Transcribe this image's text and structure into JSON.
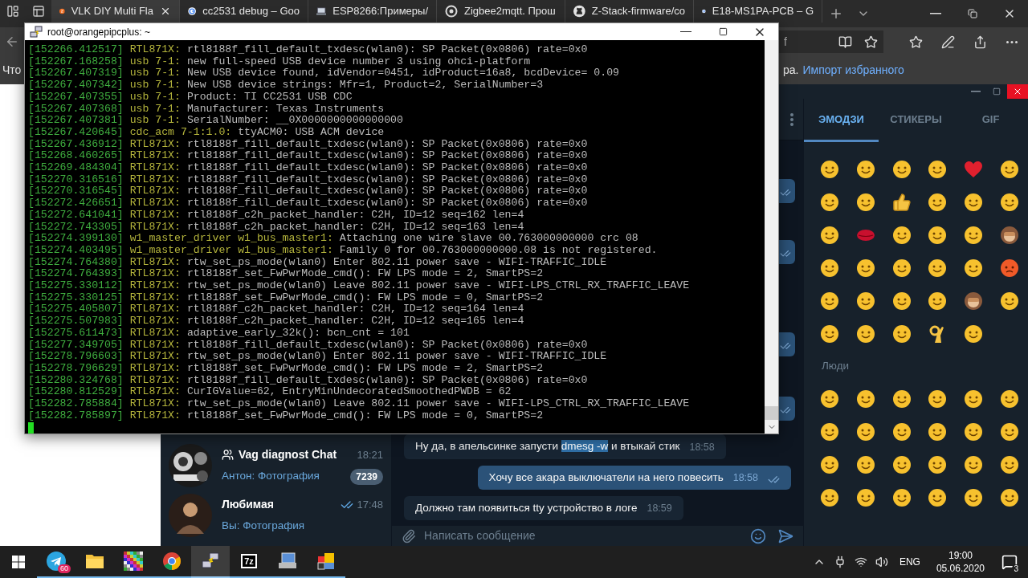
{
  "browser": {
    "tabs": [
      {
        "title": "VLK DIY Multi Fla",
        "selected": true
      },
      {
        "title": "cc2531 debug – Goo",
        "selected": false
      },
      {
        "title": "ESP8266:Примеры/",
        "selected": false
      },
      {
        "title": "Zigbee2mqtt. Прош",
        "selected": false
      },
      {
        "title": "Z-Stack-firmware/co",
        "selected": false
      },
      {
        "title": "E18-MS1PA-PCB – G",
        "selected": false
      }
    ],
    "address_fragment": "f",
    "favorites_bar": {
      "left_fragment": "Что",
      "right_fragment": "ра.",
      "link": "Импорт избранного"
    }
  },
  "telegram": {
    "chats": [
      {
        "name": "Vag diagnost Chat",
        "group": true,
        "time": "18:21",
        "preview": "Антон: Фотография",
        "unread": "7239",
        "read_receipt": false
      },
      {
        "name": "Любимая",
        "group": false,
        "time": "17:48",
        "preview": "Вы: Фотография",
        "read_receipt": true
      }
    ],
    "messages": [
      {
        "kind": "incoming",
        "parts": [
          {
            "text": "Ну да, в апельсинке запусти ",
            "selected": false
          },
          {
            "text": "dmesg -w",
            "selected": true
          },
          {
            "text": " и втыкай стик",
            "selected": false
          }
        ],
        "time": "18:58",
        "read": false
      },
      {
        "kind": "outgoing",
        "parts": [
          {
            "text": "Хочу все акара выключатели на него повесить",
            "selected": false
          }
        ],
        "time": "18:58",
        "read": true
      },
      {
        "kind": "incoming",
        "parts": [
          {
            "text": "Должно там появиться tty устройство в логе",
            "selected": false
          }
        ],
        "time": "18:59",
        "read": false
      }
    ],
    "composer": {
      "placeholder": "Написать сообщение"
    },
    "emoji_tabs": [
      {
        "label": "ЭМОДЗИ",
        "selected": true
      },
      {
        "label": "СТИКЕРЫ",
        "selected": false
      },
      {
        "label": "GIF",
        "selected": false
      }
    ],
    "section_label": "Люди"
  },
  "terminal": {
    "title": "root@orangepipcplus: ~",
    "lines": [
      {
        "timestamp": "[152266.412517]",
        "source": "RTL871X:",
        "message": "rtl8188f_fill_default_txdesc(wlan0): SP Packet(0x0806) rate=0x0"
      },
      {
        "timestamp": "[152267.168258]",
        "source": "usb 7-1:",
        "message": "new full-speed USB device number 3 using ohci-platform"
      },
      {
        "timestamp": "[152267.407319]",
        "source": "usb 7-1:",
        "message": "New USB device found, idVendor=0451, idProduct=16a8, bcdDevice= 0.09"
      },
      {
        "timestamp": "[152267.407342]",
        "source": "usb 7-1:",
        "message": "New USB device strings: Mfr=1, Product=2, SerialNumber=3"
      },
      {
        "timestamp": "[152267.407355]",
        "source": "usb 7-1:",
        "message": "Product: TI CC2531 USB CDC"
      },
      {
        "timestamp": "[152267.407368]",
        "source": "usb 7-1:",
        "message": "Manufacturer: Texas Instruments"
      },
      {
        "timestamp": "[152267.407381]",
        "source": "usb 7-1:",
        "message": "SerialNumber: __0X0000000000000000"
      },
      {
        "timestamp": "[152267.420645]",
        "source": "cdc_acm 7-1:1.0:",
        "message": "ttyACM0: USB ACM device"
      },
      {
        "timestamp": "[152267.436912]",
        "source": "RTL871X:",
        "message": "rtl8188f_fill_default_txdesc(wlan0): SP Packet(0x0806) rate=0x0"
      },
      {
        "timestamp": "[152268.460265]",
        "source": "RTL871X:",
        "message": "rtl8188f_fill_default_txdesc(wlan0): SP Packet(0x0806) rate=0x0"
      },
      {
        "timestamp": "[152269.484304]",
        "source": "RTL871X:",
        "message": "rtl8188f_fill_default_txdesc(wlan0): SP Packet(0x0806) rate=0x0"
      },
      {
        "timestamp": "[152270.316516]",
        "source": "RTL871X:",
        "message": "rtl8188f_fill_default_txdesc(wlan0): SP Packet(0x0806) rate=0x0"
      },
      {
        "timestamp": "[152270.316545]",
        "source": "RTL871X:",
        "message": "rtl8188f_fill_default_txdesc(wlan0): SP Packet(0x0806) rate=0x0"
      },
      {
        "timestamp": "[152272.426651]",
        "source": "RTL871X:",
        "message": "rtl8188f_fill_default_txdesc(wlan0): SP Packet(0x0806) rate=0x0"
      },
      {
        "timestamp": "[152272.641041]",
        "source": "RTL871X:",
        "message": "rtl8188f_c2h_packet_handler: C2H, ID=12 seq=162 len=4"
      },
      {
        "timestamp": "[152272.743305]",
        "source": "RTL871X:",
        "message": "rtl8188f_c2h_packet_handler: C2H, ID=12 seq=163 len=4"
      },
      {
        "timestamp": "[152274.399130]",
        "source": "w1_master_driver w1_bus_master1:",
        "message": "Attaching one wire slave 00.763000000000 crc 08"
      },
      {
        "timestamp": "[152274.403495]",
        "source": "w1_master_driver w1_bus_master1:",
        "message": "Family 0 for 00.763000000000.08 is not registered."
      },
      {
        "timestamp": "[152274.764380]",
        "source": "RTL871X:",
        "message": "rtw_set_ps_mode(wlan0) Enter 802.11 power save - WIFI-TRAFFIC_IDLE"
      },
      {
        "timestamp": "[152274.764393]",
        "source": "RTL871X:",
        "message": "rtl8188f_set_FwPwrMode_cmd(): FW LPS mode = 2, SmartPS=2"
      },
      {
        "timestamp": "[152275.330112]",
        "source": "RTL871X:",
        "message": "rtw_set_ps_mode(wlan0) Leave 802.11 power save - WIFI-LPS_CTRL_RX_TRAFFIC_LEAVE"
      },
      {
        "timestamp": "[152275.330125]",
        "source": "RTL871X:",
        "message": "rtl8188f_set_FwPwrMode_cmd(): FW LPS mode = 0, SmartPS=2"
      },
      {
        "timestamp": "[152275.405807]",
        "source": "RTL871X:",
        "message": "rtl8188f_c2h_packet_handler: C2H, ID=12 seq=164 len=4"
      },
      {
        "timestamp": "[152275.507983]",
        "source": "RTL871X:",
        "message": "rtl8188f_c2h_packet_handler: C2H, ID=12 seq=165 len=4"
      },
      {
        "timestamp": "[152275.611473]",
        "source": "RTL871X:",
        "message": "adaptive_early_32k(): bcn_cnt = 101"
      },
      {
        "timestamp": "[152277.349705]",
        "source": "RTL871X:",
        "message": "rtl8188f_fill_default_txdesc(wlan0): SP Packet(0x0806) rate=0x0"
      },
      {
        "timestamp": "[152278.796603]",
        "source": "RTL871X:",
        "message": "rtw_set_ps_mode(wlan0) Enter 802.11 power save - WIFI-TRAFFIC_IDLE"
      },
      {
        "timestamp": "[152278.796629]",
        "source": "RTL871X:",
        "message": "rtl8188f_set_FwPwrMode_cmd(): FW LPS mode = 2, SmartPS=2"
      },
      {
        "timestamp": "[152280.324768]",
        "source": "RTL871X:",
        "message": "rtl8188f_fill_default_txdesc(wlan0): SP Packet(0x0806) rate=0x0"
      },
      {
        "timestamp": "[152280.812529]",
        "source": "RTL871X:",
        "message": "CurIGValue=62, EntryMinUndecoratedSmoothedPWDB = 62"
      },
      {
        "timestamp": "[152282.785884]",
        "source": "RTL871X:",
        "message": "rtw_set_ps_mode(wlan0) Leave 802.11 power save - WIFI-LPS_CTRL_RX_TRAFFIC_LEAVE"
      },
      {
        "timestamp": "[152282.785897]",
        "source": "RTL871X:",
        "message": "rtl8188f_set_FwPwrMode_cmd(): FW LPS mode = 0, SmartPS=2"
      }
    ]
  },
  "taskbar": {
    "apps": [
      {
        "kind": "telegram",
        "running": true,
        "active": false,
        "badge": "60"
      },
      {
        "kind": "explorer",
        "running": true,
        "active": false
      },
      {
        "kind": "mosaic",
        "running": true,
        "active": false
      },
      {
        "kind": "chrome",
        "running": true,
        "active": false
      },
      {
        "kind": "putty",
        "running": true,
        "active": true
      },
      {
        "kind": "sevenzip",
        "running": true,
        "active": false,
        "label": "7z"
      },
      {
        "kind": "network",
        "running": true,
        "active": false
      },
      {
        "kind": "squares",
        "running": true,
        "active": false
      }
    ],
    "language": "ENG",
    "time": "19:00",
    "date": "05.06.2020",
    "notifications": "3"
  }
}
